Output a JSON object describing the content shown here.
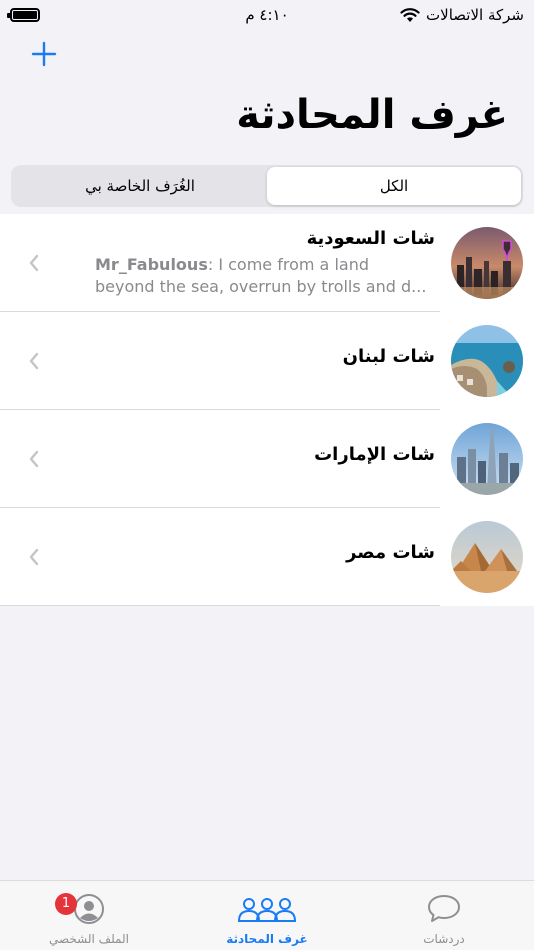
{
  "status_bar": {
    "time": "٤:١٠ م",
    "carrier": "شركة الاتصالات"
  },
  "header": {
    "title": "غرف المحادثة",
    "add_icon": "plus-icon"
  },
  "segments": {
    "all": "الكل",
    "private": "الغُرَف الخاصة بي"
  },
  "rooms": [
    {
      "title": "شات السعودية",
      "sender": "Mr_Fabulous",
      "message_line1": ": I come from a land",
      "message_line2": "beyond the sea, overrun by trolls and d...",
      "avatar": "riyadh-skyline"
    },
    {
      "title": "شات لبنان",
      "avatar": "lebanon-coast"
    },
    {
      "title": "شات الإمارات",
      "avatar": "dubai-skyline"
    },
    {
      "title": "شات مصر",
      "avatar": "giza-pyramids"
    }
  ],
  "tabbar": {
    "profile": "الملف الشخصي",
    "profile_badge": "1",
    "rooms": "غرف المحادثة",
    "chats": "دردشات"
  },
  "colors": {
    "accent": "#1a7cf5",
    "badge": "#e5333a",
    "background": "#f2f2f7"
  }
}
